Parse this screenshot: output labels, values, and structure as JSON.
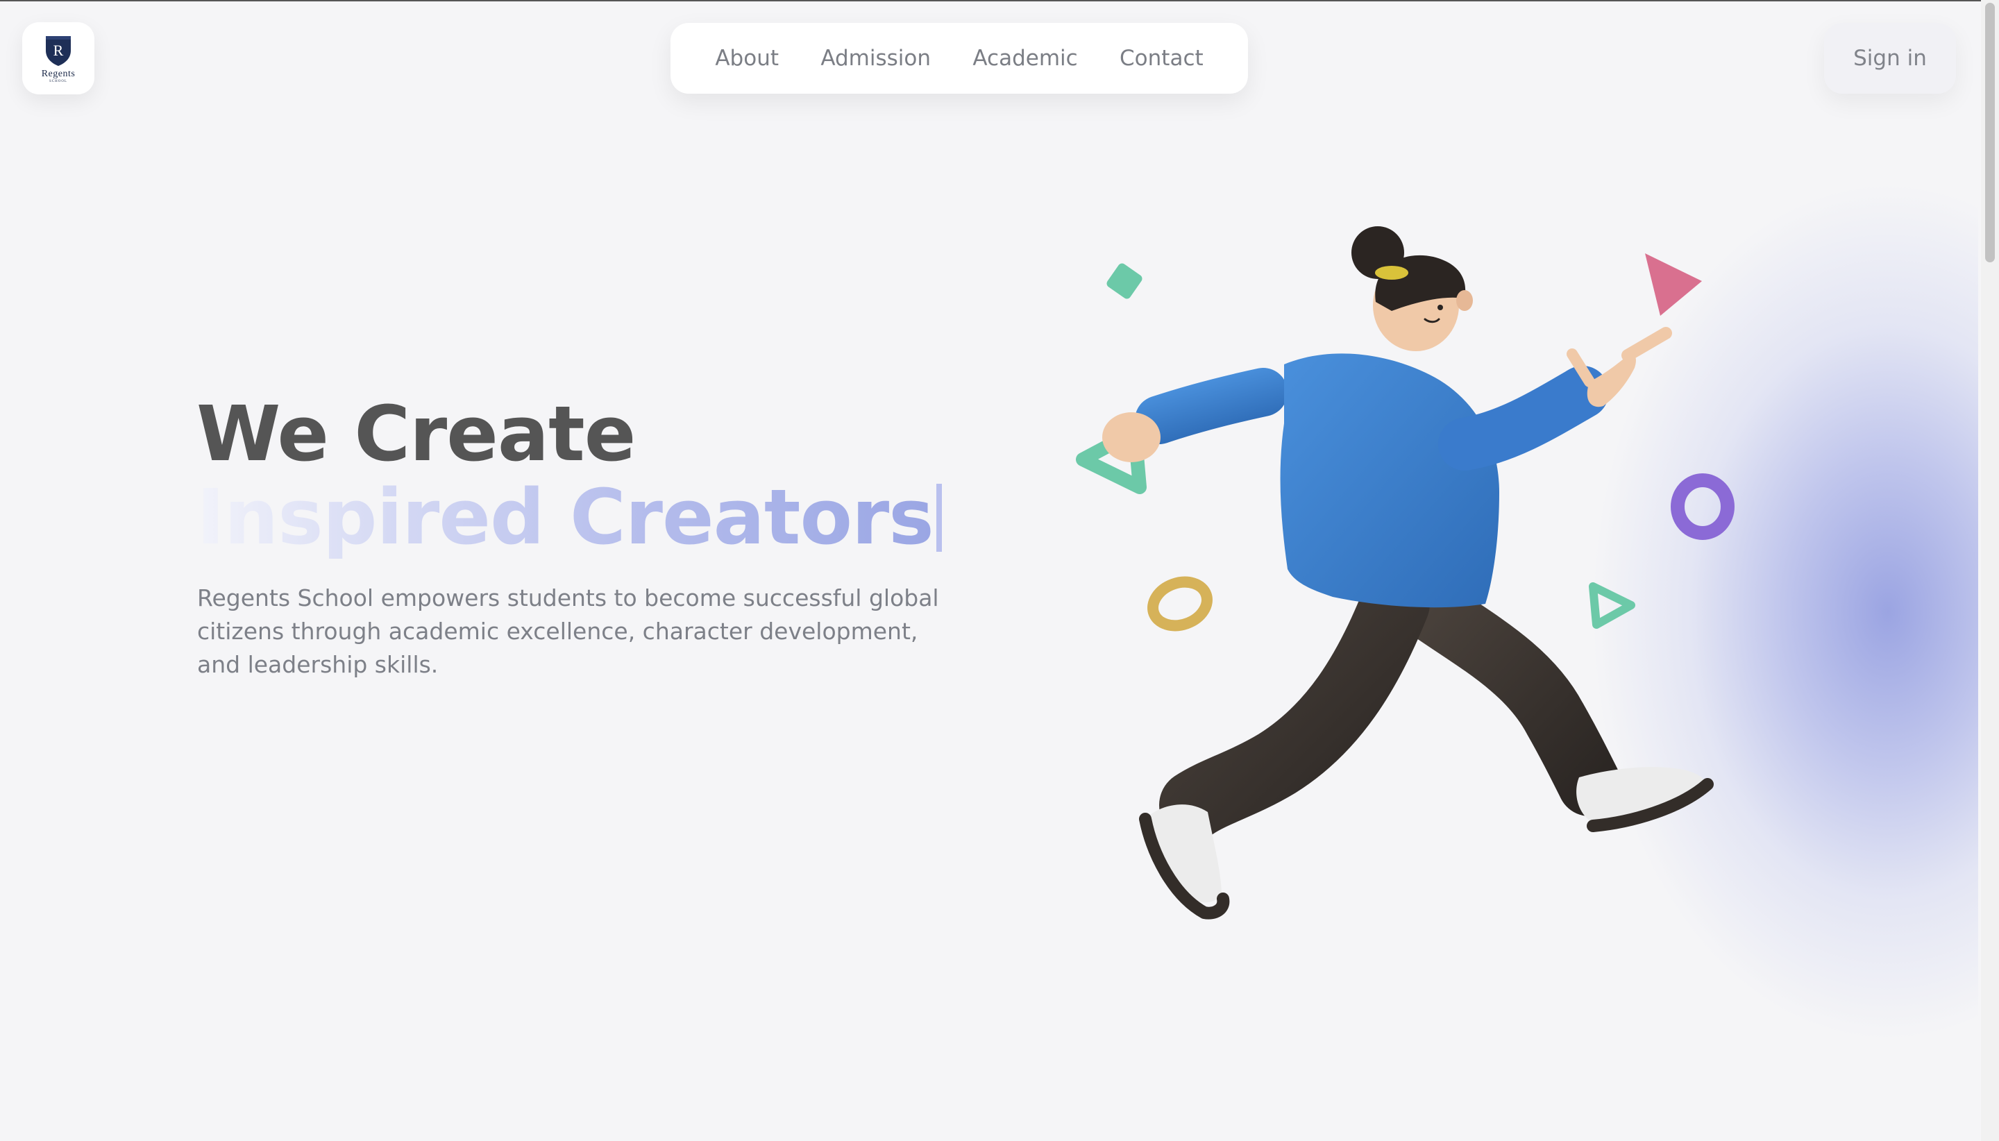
{
  "brand": {
    "logo_text": "Regents",
    "logo_sub": "SCHOOL",
    "crest_letter": "R"
  },
  "nav": {
    "items": [
      {
        "label": "About"
      },
      {
        "label": "Admission"
      },
      {
        "label": "Academic"
      },
      {
        "label": "Contact"
      }
    ]
  },
  "auth": {
    "signin_label": "Sign in"
  },
  "hero": {
    "line1": "We Create",
    "line2": "Inspired Creators",
    "description": "Regents School empowers students to become successful global citizens through academic excellence, character development, and leadership skills."
  },
  "colors": {
    "accent": "#9aa6e4",
    "text_dark": "#555555",
    "muted": "#7d8088",
    "shirt": "#3e82cf",
    "pants": "#3a3430"
  },
  "illustration": {
    "icon": "running-student-illustration"
  }
}
